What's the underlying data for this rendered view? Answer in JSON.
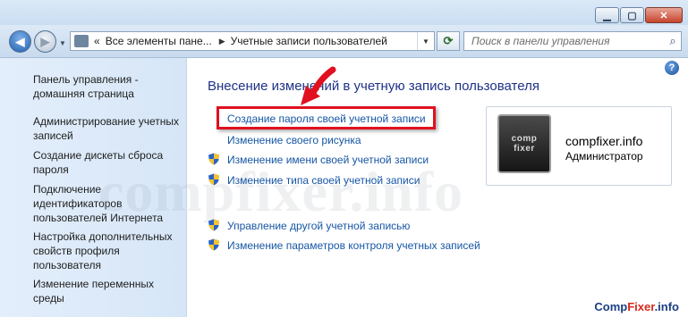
{
  "window": {
    "minimize_symbol": "▁",
    "maximize_symbol": "▢",
    "close_symbol": "✕"
  },
  "nav": {
    "breadcrumb": [
      "«",
      "Все элементы пане...",
      "Учетные записи пользователей"
    ],
    "search_placeholder": "Поиск в панели управления"
  },
  "sidebar": {
    "items": [
      "Панель управления -\nдомашняя страница",
      "Администрирование учетных\nзаписей",
      "Создание дискеты сброса\nпароля",
      "Подключение\nидентификаторов\nпользователей Интернета",
      "Настройка дополнительных\nсвойств профиля\nпользователя",
      "Изменение переменных\nсреды"
    ]
  },
  "main": {
    "heading": "Внесение изменений в учетную запись пользователя",
    "tasks": [
      {
        "label": "Создание пароля своей учетной записи",
        "shield": false,
        "highlighted": true
      },
      {
        "label": "Изменение своего рисунка",
        "shield": false
      },
      {
        "label": "Изменение имени своей учетной записи",
        "shield": true
      },
      {
        "label": "Изменение типа своей учетной записи",
        "shield": true
      },
      {
        "label": "Управление другой учетной записью",
        "shield": true
      },
      {
        "label": "Изменение параметров контроля учетных записей",
        "shield": true
      }
    ],
    "help": "?"
  },
  "user": {
    "name": "compfixer.info",
    "role": "Администратор",
    "avatar_text": "comp\nfixer"
  },
  "branding": {
    "watermark": "compfixer.info",
    "site_a": "Comp",
    "site_b": "Fixer",
    "site_c": ".info"
  },
  "colors": {
    "link": "#1656a5",
    "heading": "#1e3287",
    "highlight": "#e01020"
  }
}
